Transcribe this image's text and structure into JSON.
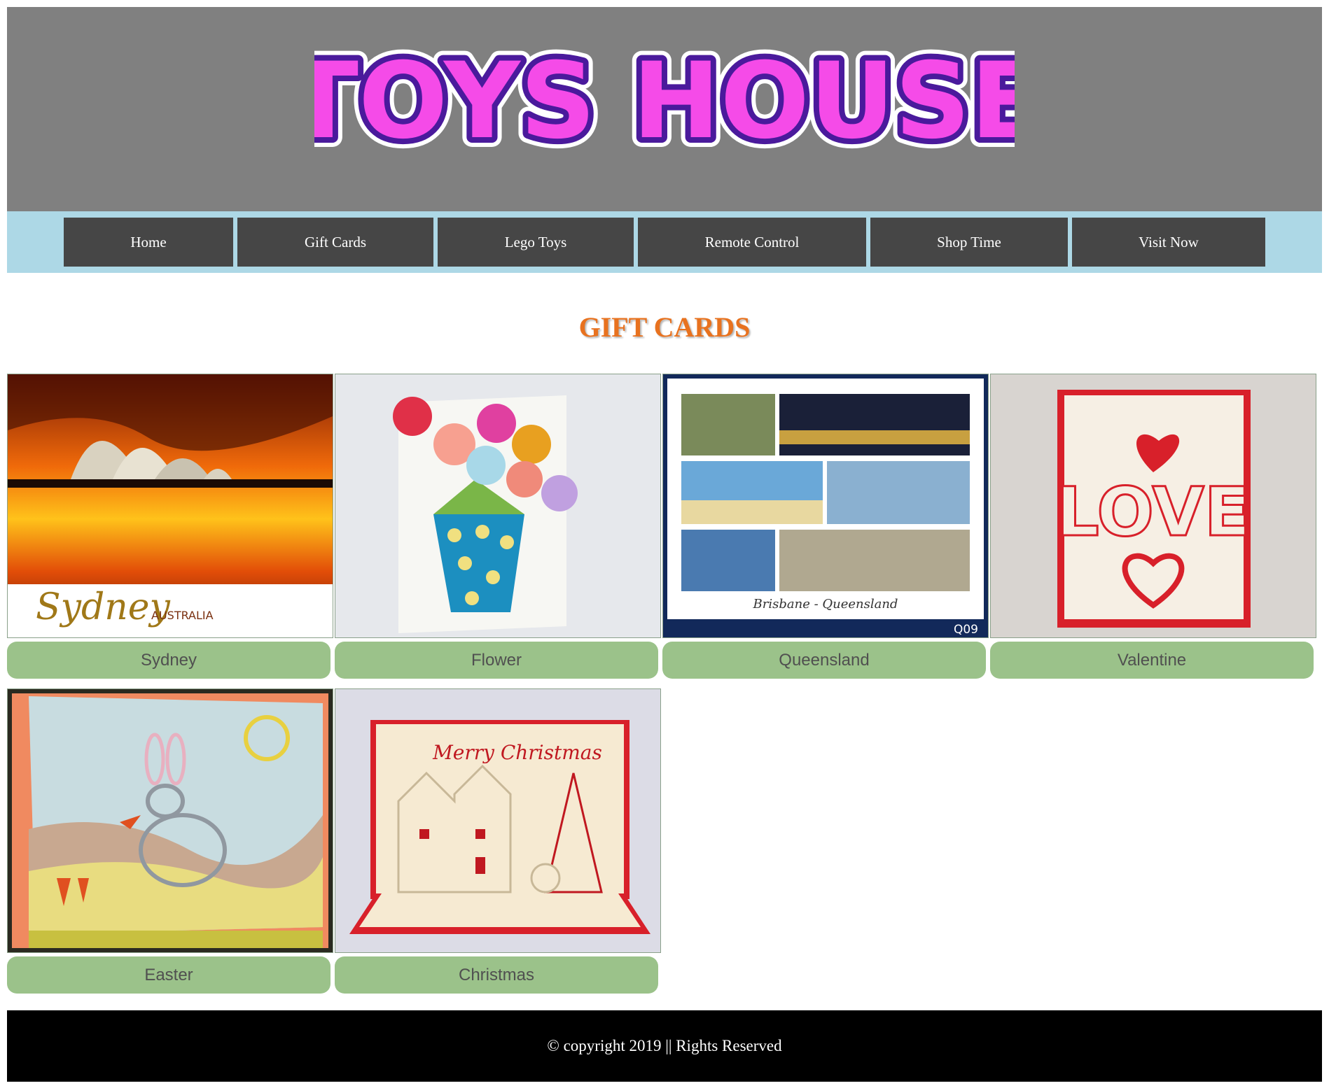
{
  "header": {
    "logo_text": "TOYS HOUSE"
  },
  "nav": {
    "items": [
      {
        "label": "Home"
      },
      {
        "label": "Gift Cards"
      },
      {
        "label": "Lego Toys"
      },
      {
        "label": "Remote Control"
      },
      {
        "label": "Shop Time"
      },
      {
        "label": "Visit Now"
      }
    ]
  },
  "main": {
    "title": "GIFT CARDS",
    "cards": [
      {
        "caption": "Sydney",
        "image_text": "Sydney",
        "image_subtext": "AUSTRALIA"
      },
      {
        "caption": "Flower"
      },
      {
        "caption": "Queensland",
        "image_text": "Brisbane - Queensland",
        "image_code": "Q09"
      },
      {
        "caption": "Valentine",
        "image_text": "LOVE"
      },
      {
        "caption": "Easter"
      },
      {
        "caption": "Christmas",
        "image_text": "Merry Christmas"
      }
    ]
  },
  "footer": {
    "text": "© copyright 2019 || Rights Reserved"
  },
  "colors": {
    "header_bg": "#808080",
    "nav_bg": "#add8e6",
    "nav_item_bg": "#464646",
    "title": "#e8721f",
    "caption_bg": "#9bc28a",
    "footer_bg": "#000000"
  }
}
